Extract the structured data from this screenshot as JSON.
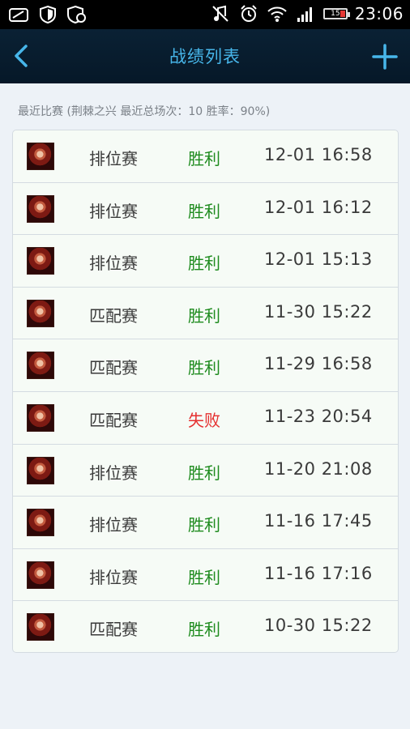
{
  "status_bar": {
    "icons_left": [
      "messages-icon",
      "shield-icon",
      "security-sync-icon"
    ],
    "icons_right": [
      "music-mute-icon",
      "alarm-icon",
      "wifi-icon",
      "signal-icon"
    ],
    "battery_level": "15",
    "time": "23:06"
  },
  "nav": {
    "title": "战绩列表",
    "back_icon": "chevron-left-icon",
    "add_icon": "plus-icon",
    "accent_color": "#47b6ea"
  },
  "summary": "最近比赛 (荆棘之兴 最近总场次：10 胜率：90%)",
  "colors": {
    "win": "#1e8b1e",
    "loss": "#e52f2f"
  },
  "matches": [
    {
      "mode": "排位赛",
      "result": "胜利",
      "time": "12-01 16:58"
    },
    {
      "mode": "排位赛",
      "result": "胜利",
      "time": "12-01 16:12"
    },
    {
      "mode": "排位赛",
      "result": "胜利",
      "time": "12-01 15:13"
    },
    {
      "mode": "匹配赛",
      "result": "胜利",
      "time": "11-30 15:22"
    },
    {
      "mode": "匹配赛",
      "result": "胜利",
      "time": "11-29 16:58"
    },
    {
      "mode": "匹配赛",
      "result": "失败",
      "time": "11-23 20:54"
    },
    {
      "mode": "排位赛",
      "result": "胜利",
      "time": "11-20 21:08"
    },
    {
      "mode": "排位赛",
      "result": "胜利",
      "time": "11-16 17:45"
    },
    {
      "mode": "排位赛",
      "result": "胜利",
      "time": "11-16 17:16"
    },
    {
      "mode": "匹配赛",
      "result": "胜利",
      "time": "10-30 15:22"
    }
  ]
}
